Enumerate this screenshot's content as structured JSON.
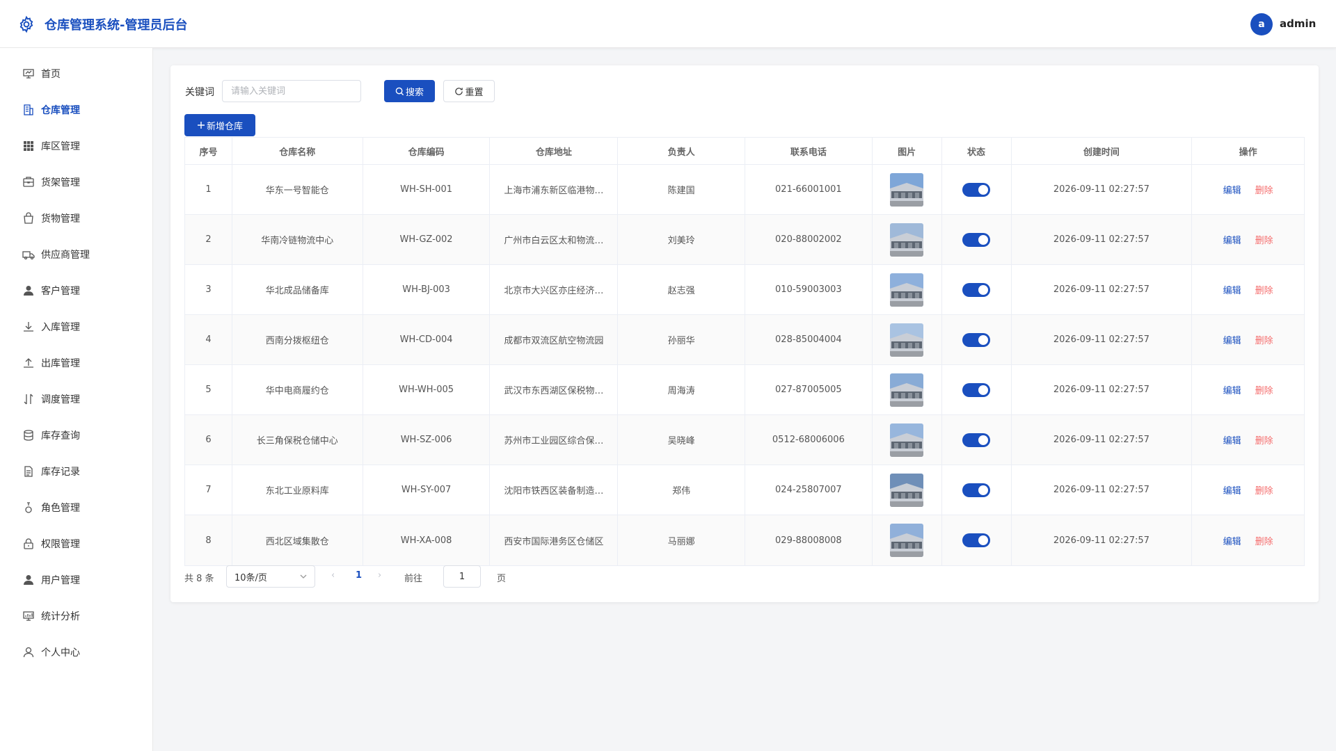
{
  "header": {
    "title": "仓库管理系统-管理员后台",
    "avatar_letter": "a",
    "username": "admin"
  },
  "sidebar": {
    "items": [
      {
        "label": "首页",
        "icon": "dashboard-icon"
      },
      {
        "label": "仓库管理",
        "icon": "building-icon",
        "active": true
      },
      {
        "label": "库区管理",
        "icon": "grid-icon"
      },
      {
        "label": "货架管理",
        "icon": "shelf-icon"
      },
      {
        "label": "货物管理",
        "icon": "bag-icon"
      },
      {
        "label": "供应商管理",
        "icon": "truck-icon"
      },
      {
        "label": "客户管理",
        "icon": "user-icon"
      },
      {
        "label": "入库管理",
        "icon": "download-icon"
      },
      {
        "label": "出库管理",
        "icon": "upload-icon"
      },
      {
        "label": "调度管理",
        "icon": "transfer-icon"
      },
      {
        "label": "库存查询",
        "icon": "database-icon"
      },
      {
        "label": "库存记录",
        "icon": "document-icon"
      },
      {
        "label": "角色管理",
        "icon": "role-icon"
      },
      {
        "label": "权限管理",
        "icon": "lock-icon"
      },
      {
        "label": "用户管理",
        "icon": "user-icon"
      },
      {
        "label": "统计分析",
        "icon": "chart-icon"
      },
      {
        "label": "个人中心",
        "icon": "profile-icon"
      }
    ]
  },
  "search": {
    "label": "关键词",
    "placeholder": "请输入关键词",
    "search_button": "搜索",
    "reset_button": "重置",
    "add_button": "新增仓库"
  },
  "table": {
    "columns": [
      "序号",
      "仓库名称",
      "仓库编码",
      "仓库地址",
      "负责人",
      "联系电话",
      "图片",
      "状态",
      "创建时间",
      "操作"
    ],
    "edit_label": "编辑",
    "delete_label": "删除",
    "rows": [
      {
        "index": "1",
        "name": "华东一号智能仓",
        "code": "WH-SH-001",
        "address": "上海市浦东新区临港物…",
        "manager": "陈建国",
        "phone": "021-66001001",
        "status": true,
        "created": "2026-09-11 02:27:57"
      },
      {
        "index": "2",
        "name": "华南冷链物流中心",
        "code": "WH-GZ-002",
        "address": "广州市白云区太和物流…",
        "manager": "刘美玲",
        "phone": "020-88002002",
        "status": true,
        "created": "2026-09-11 02:27:57"
      },
      {
        "index": "3",
        "name": "华北成品储备库",
        "code": "WH-BJ-003",
        "address": "北京市大兴区亦庄经济…",
        "manager": "赵志强",
        "phone": "010-59003003",
        "status": true,
        "created": "2026-09-11 02:27:57"
      },
      {
        "index": "4",
        "name": "西南分拨枢纽仓",
        "code": "WH-CD-004",
        "address": "成都市双流区航空物流园",
        "manager": "孙丽华",
        "phone": "028-85004004",
        "status": true,
        "created": "2026-09-11 02:27:57"
      },
      {
        "index": "5",
        "name": "华中电商履约仓",
        "code": "WH-WH-005",
        "address": "武汉市东西湖区保税物…",
        "manager": "周海涛",
        "phone": "027-87005005",
        "status": true,
        "created": "2026-09-11 02:27:57"
      },
      {
        "index": "6",
        "name": "长三角保税仓储中心",
        "code": "WH-SZ-006",
        "address": "苏州市工业园区综合保…",
        "manager": "吴晓峰",
        "phone": "0512-68006006",
        "status": true,
        "created": "2026-09-11 02:27:57"
      },
      {
        "index": "7",
        "name": "东北工业原料库",
        "code": "WH-SY-007",
        "address": "沈阳市铁西区装备制造…",
        "manager": "郑伟",
        "phone": "024-25807007",
        "status": true,
        "created": "2026-09-11 02:27:57"
      },
      {
        "index": "8",
        "name": "西北区域集散仓",
        "code": "WH-XA-008",
        "address": "西安市国际港务区仓储区",
        "manager": "马丽娜",
        "phone": "029-88008008",
        "status": true,
        "created": "2026-09-11 02:27:57"
      }
    ]
  },
  "pagination": {
    "total_text": "共 8 条",
    "page_size": "10条/页",
    "current_page": "1",
    "goto_label": "前往",
    "goto_value": "1",
    "goto_unit": "页"
  },
  "colors": {
    "primary": "#1a4fbf",
    "danger": "#f56c6c"
  }
}
